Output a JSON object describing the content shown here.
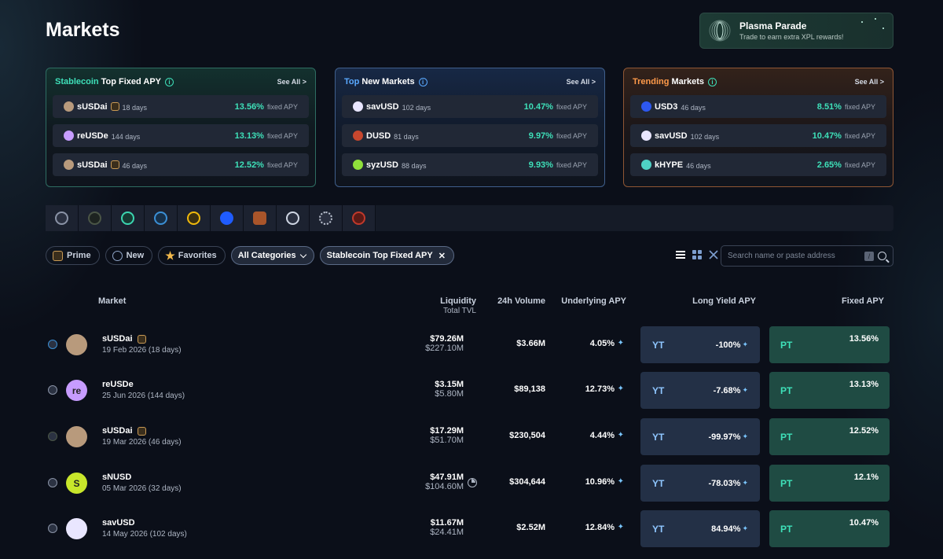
{
  "page": {
    "title": "Markets"
  },
  "promo": {
    "title": "Plasma Parade",
    "subtitle": "Trade to earn extra XPL rewards!"
  },
  "cards": [
    {
      "accent": "Stablecoin",
      "rest": "Top Fixed APY",
      "see_all": "See All >",
      "rows": [
        {
          "name": "sUSDai",
          "days": "18 days",
          "apy": "13.56%",
          "apy_label": "fixed APY",
          "shield": true,
          "coin_color": "#b89a7c"
        },
        {
          "name": "reUSDe",
          "days": "144 days",
          "apy": "13.13%",
          "apy_label": "fixed APY",
          "shield": false,
          "coin_color": "#c79cff"
        },
        {
          "name": "sUSDai",
          "days": "46 days",
          "apy": "12.52%",
          "apy_label": "fixed APY",
          "shield": true,
          "coin_color": "#b89a7c"
        }
      ]
    },
    {
      "accent": "Top",
      "rest": "New Markets",
      "see_all": "See All >",
      "rows": [
        {
          "name": "savUSD",
          "days": "102 days",
          "apy": "10.47%",
          "apy_label": "fixed APY",
          "coin_color": "#e9e6ff"
        },
        {
          "name": "DUSD",
          "days": "81 days",
          "apy": "9.97%",
          "apy_label": "fixed APY",
          "coin_color": "#c7472e"
        },
        {
          "name": "syzUSD",
          "days": "88 days",
          "apy": "9.93%",
          "apy_label": "fixed APY",
          "coin_color": "#8fe03b"
        }
      ]
    },
    {
      "accent": "Trending",
      "rest": "Markets",
      "see_all": "See All >",
      "rows": [
        {
          "name": "USD3",
          "days": "46 days",
          "apy": "8.51%",
          "apy_label": "fixed APY",
          "coin_color": "#2d58f0"
        },
        {
          "name": "savUSD",
          "days": "102 days",
          "apy": "10.47%",
          "apy_label": "fixed APY",
          "coin_color": "#e9e6ff"
        },
        {
          "name": "kHYPE",
          "days": "46 days",
          "apy": "2.65%",
          "apy_label": "fixed APY",
          "coin_color": "#4fd1c5"
        }
      ]
    }
  ],
  "chains": [
    {
      "icon": "ethereum-chain-icon",
      "color": "#8a93a6"
    },
    {
      "icon": "chain-2-icon",
      "color": "#4a5546"
    },
    {
      "icon": "chain-3-icon",
      "color": "#3bd5b0"
    },
    {
      "icon": "chain-4-icon",
      "color": "#3b8fd5"
    },
    {
      "icon": "bnb-chain-icon",
      "color": "#f0b90b"
    },
    {
      "icon": "base-chain-icon",
      "color": "#1f5cff"
    },
    {
      "icon": "chain-7-icon",
      "color": "#a9552a"
    },
    {
      "icon": "chain-8-icon",
      "color": "#cfd6e3"
    },
    {
      "icon": "chain-9-icon",
      "color": "#bfc6d3"
    },
    {
      "icon": "optimism-chain-icon",
      "color": "#c0392b"
    }
  ],
  "filters": {
    "prime": "Prime",
    "new": "New",
    "favorites": "Favorites",
    "categories": "All Categories",
    "active": "Stablecoin Top Fixed APY"
  },
  "search": {
    "placeholder": "Search name or paste address",
    "shortcut": "/"
  },
  "table": {
    "headers": {
      "market": "Market",
      "liquidity": "Liquidity",
      "total_tvl": "Total TVL",
      "volume": "24h Volume",
      "underlying": "Underlying APY",
      "long_yield": "Long Yield APY",
      "fixed": "Fixed APY"
    },
    "rows": [
      {
        "name": "sUSDai",
        "date": "19 Feb 2026 (18 days)",
        "liquidity": "$79.26M",
        "tvl": "$227.10M",
        "volume": "$3.66M",
        "underlying": "4.05%",
        "yt_label": "YT",
        "long_yield": "-100%",
        "pt_label": "PT",
        "fixed": "13.56%",
        "shield": true,
        "avatar_color": "#b89a7c",
        "avatar_text": ""
      },
      {
        "name": "reUSDe",
        "date": "25 Jun 2026 (144 days)",
        "liquidity": "$3.15M",
        "tvl": "$5.80M",
        "volume": "$89,138",
        "underlying": "12.73%",
        "yt_label": "YT",
        "long_yield": "-7.68%",
        "pt_label": "PT",
        "fixed": "13.13%",
        "shield": false,
        "avatar_color": "#c79cff",
        "avatar_text": "re"
      },
      {
        "name": "sUSDai",
        "date": "19 Mar 2026 (46 days)",
        "liquidity": "$17.29M",
        "tvl": "$51.70M",
        "volume": "$230,504",
        "underlying": "4.44%",
        "yt_label": "YT",
        "long_yield": "-99.97%",
        "pt_label": "PT",
        "fixed": "12.52%",
        "shield": true,
        "avatar_color": "#b89a7c",
        "avatar_text": ""
      },
      {
        "name": "sNUSD",
        "date": "05 Mar 2026 (32 days)",
        "liquidity": "$47.91M",
        "tvl": "$104.60M",
        "volume": "$304,644",
        "underlying": "10.96%",
        "yt_label": "YT",
        "long_yield": "-78.03%",
        "pt_label": "PT",
        "fixed": "12.1%",
        "shield": false,
        "avatar_color": "#c8e62b",
        "avatar_text": "S"
      },
      {
        "name": "savUSD",
        "date": "14 May 2026 (102 days)",
        "liquidity": "$11.67M",
        "tvl": "$24.41M",
        "volume": "$2.52M",
        "underlying": "12.84%",
        "yt_label": "YT",
        "long_yield": "84.94%",
        "pt_label": "PT",
        "fixed": "10.47%",
        "shield": false,
        "avatar_color": "#e9e6ff",
        "avatar_text": ""
      }
    ]
  }
}
